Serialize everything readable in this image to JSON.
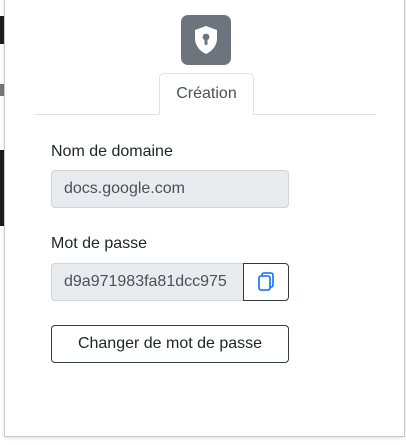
{
  "header": {
    "logo_icon": "shield-keyhole-icon"
  },
  "tabs": [
    {
      "label": "Création",
      "active": true
    }
  ],
  "form": {
    "domain_label": "Nom de domaine",
    "domain_value": "docs.google.com",
    "password_label": "Mot de passe",
    "password_value": "d9a971983fa81dcc975",
    "copy_icon": "copy-icon",
    "change_button_label": "Changer de mot de passe"
  },
  "colors": {
    "logo_bg": "#6c757d",
    "accent": "#0d6efd",
    "readonly_bg": "#e9ecef",
    "button_border": "#343a40"
  }
}
